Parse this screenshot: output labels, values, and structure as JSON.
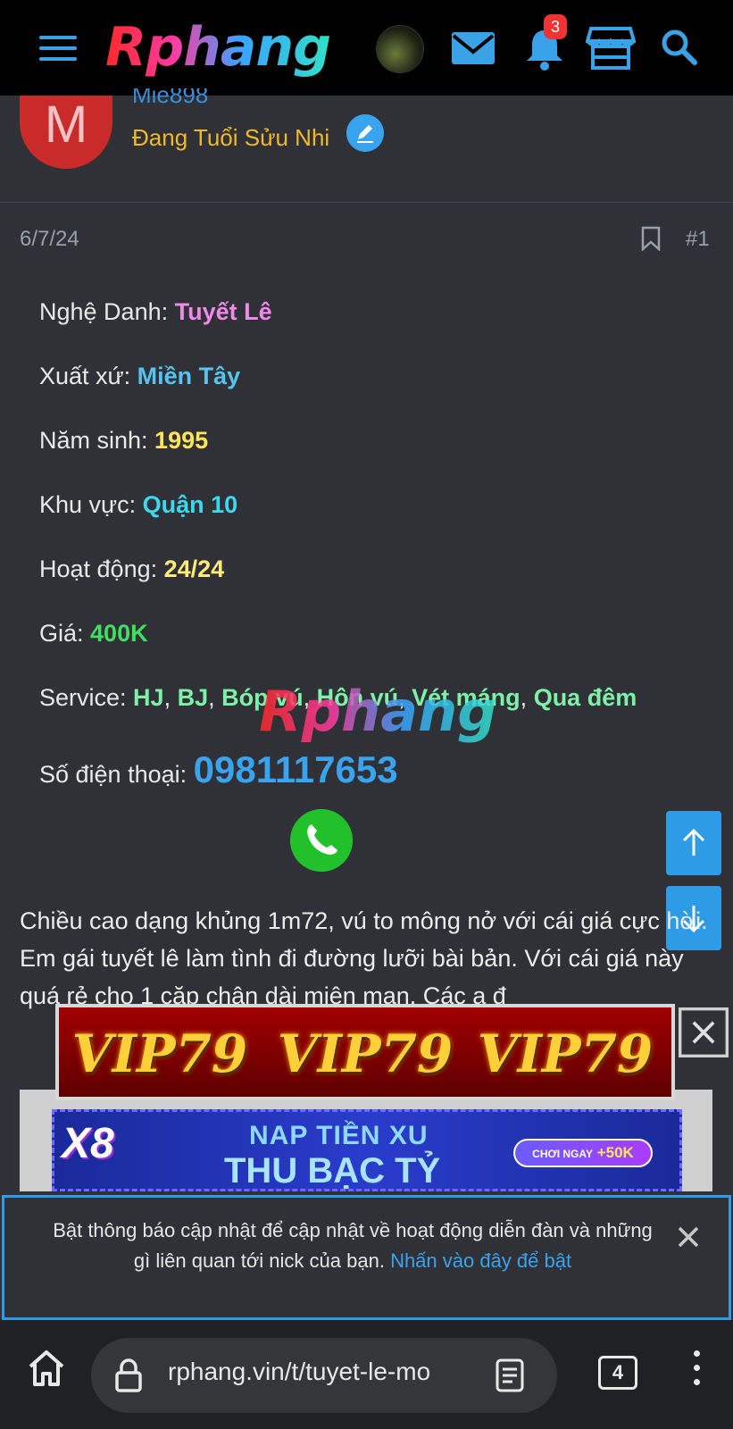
{
  "header": {
    "logo_text": "Rphang",
    "notification_count": "3",
    "accent_color": "#3aa3e8"
  },
  "poster": {
    "avatar_letter": "M",
    "name": "Mie898",
    "title": "Đang Tuổi Sửu Nhi"
  },
  "post": {
    "date": "6/7/24",
    "number": "#1"
  },
  "info": [
    {
      "label": "Nghệ Danh: ",
      "value": "Tuyết Lê"
    },
    {
      "label": "Xuất xứ: ",
      "value": "Miền Tây"
    },
    {
      "label": "Năm sinh: ",
      "value": "1995"
    },
    {
      "label": "Khu vực: ",
      "value": "Quận 10"
    },
    {
      "label": "Hoạt động: ",
      "value": "24/24"
    },
    {
      "label": "Giá: ",
      "value": "400K"
    }
  ],
  "service": {
    "label": "Service: ",
    "items": [
      "HJ",
      "BJ",
      "Bóp vú",
      "Hôn vú",
      "Vét máng",
      "Qua đêm"
    ],
    "separator": ", "
  },
  "phone": {
    "label": "Số điện thoại: ",
    "value": "0981117653"
  },
  "watermark": "Rphang",
  "body": {
    "text": "Chiều cao dạng khủng 1m72, vú to mông nở với cái giá cực hời. Em gái tuyết lê làm tình đi đường lưỡi bài bản. Với cái giá này quá rẻ cho 1 cặp chân dài miên man. Các a đ"
  },
  "ads": {
    "vip_label": "VIP79",
    "x8_logo": "X8",
    "x8_line1": "NAP TIỀN XU",
    "x8_line2": "THU BẠC TỶ",
    "x8_cta_small": "CHƠI NGAY",
    "x8_cta_value": "+50K"
  },
  "notification": {
    "text": "Bật thông báo cập nhật để cập nhật về hoạt động diễn đàn và những gì liên quan tới nick của bạn. ",
    "link": "Nhấn vào đây để bật"
  },
  "browser": {
    "url": "rphang.vin/t/tuyet-le-mo",
    "tab_count": "4"
  }
}
